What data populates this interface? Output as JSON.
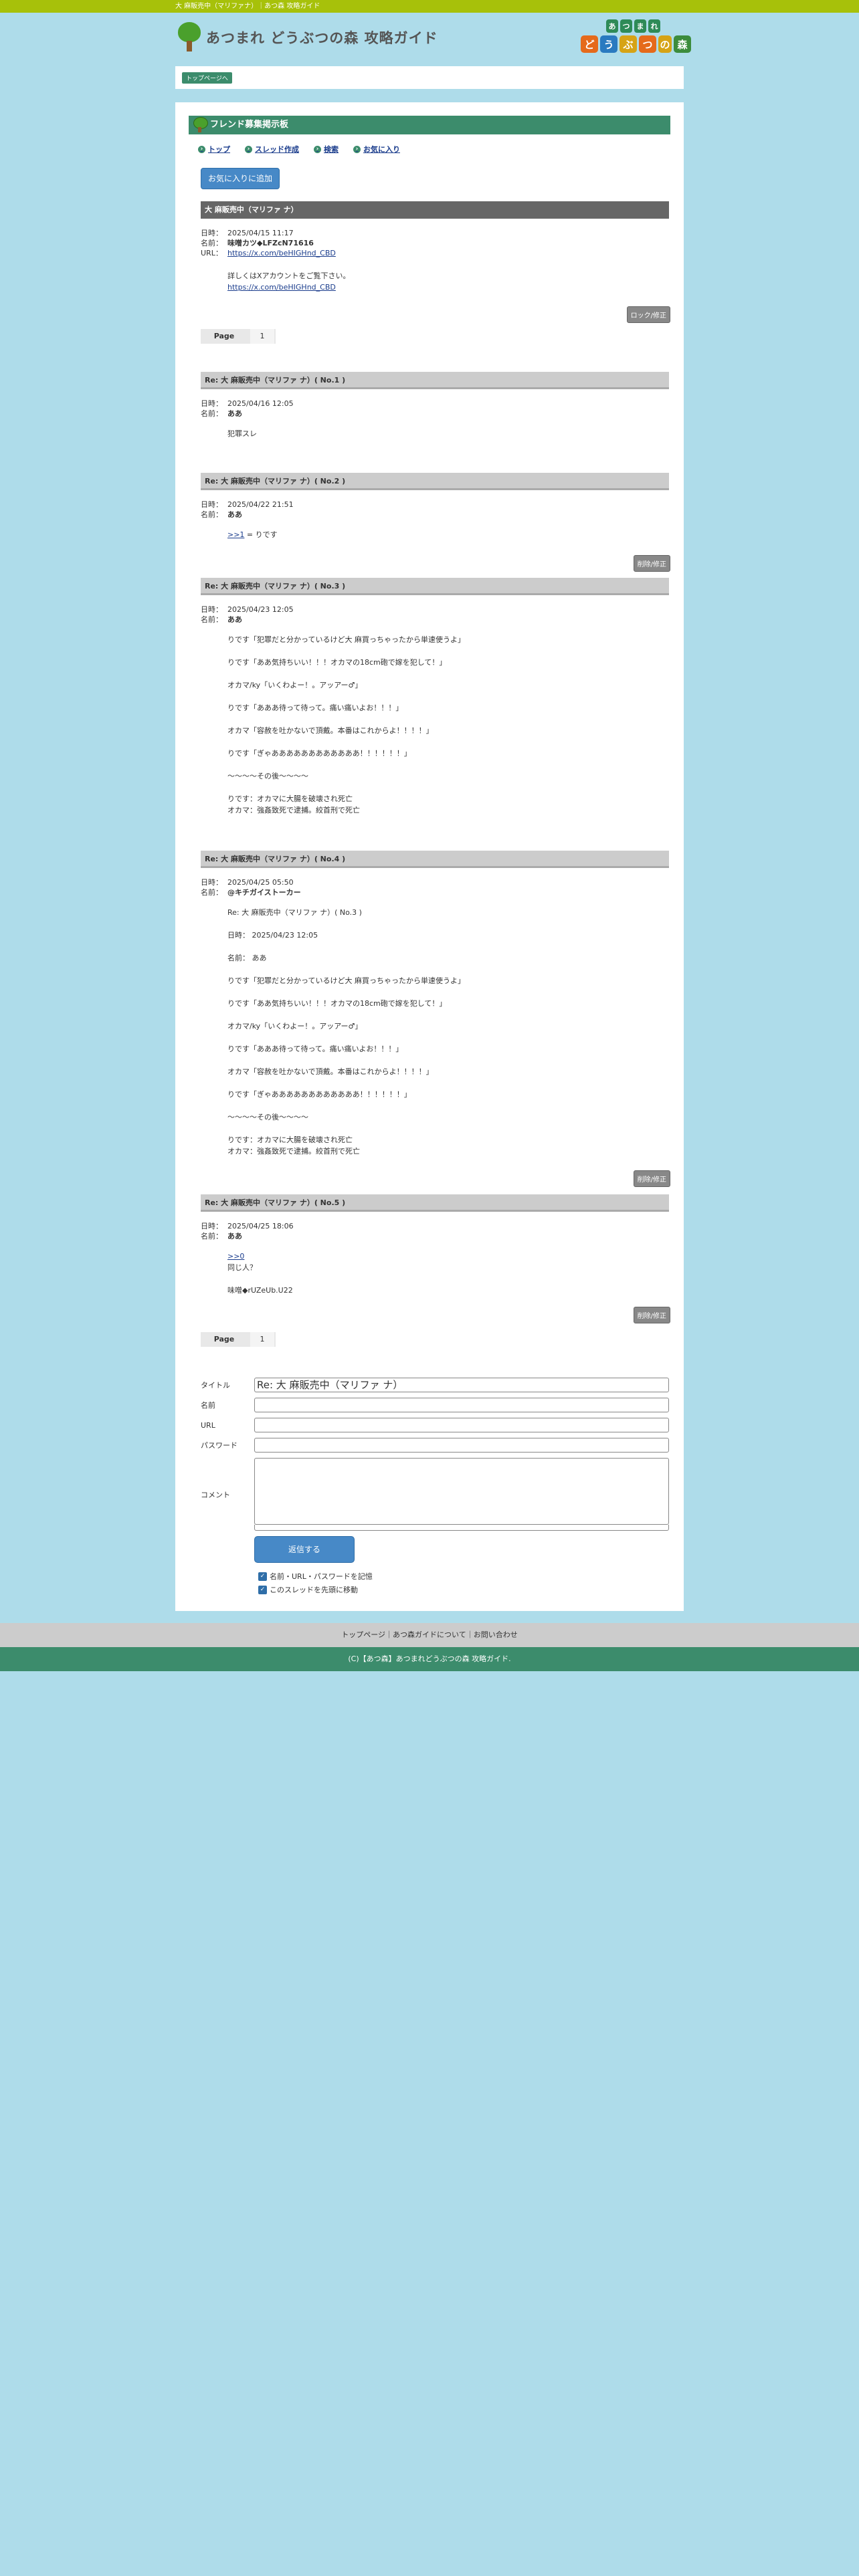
{
  "topbar": {
    "title": "大 麻販売中（マリファナ）｜あつ森 攻略ガイド"
  },
  "header": {
    "site_title": "あつまれ どうぶつの森 攻略ガイド",
    "corner_logo": {
      "top": [
        "あ",
        "つ",
        "ま",
        "れ"
      ],
      "bottom": [
        "ど",
        "う",
        "ぶ",
        "つ",
        "の",
        "森"
      ]
    },
    "colors": {
      "green": "#3c8c6c",
      "yellowgreen": "#a7c10a"
    }
  },
  "breadcrumb": {
    "label": "トップページへ"
  },
  "board": {
    "title": "フレンド募集掲示板",
    "nav": [
      {
        "label": "トップ",
        "icon": "circle-arrow-icon"
      },
      {
        "label": "スレッド作成",
        "icon": "circle-arrow-icon"
      },
      {
        "label": "検索",
        "icon": "circle-arrow-icon"
      },
      {
        "label": "お気に入り",
        "icon": "circle-arrow-icon"
      }
    ],
    "fav_button": "お気に入りに追加"
  },
  "thread": {
    "title": "大 麻販売中（マリファ ナ）",
    "date_label": "日時：",
    "name_label": "名前：",
    "url_label": "URL：",
    "date": "2025/04/15 11:17",
    "name": "味噌カツ◆LFZcN71616",
    "url": "https://x.com/beHIGHnd_CBD",
    "body_lines": [
      "詳しくはXアカウントをご覧下さい。"
    ],
    "body_link": "https://x.com/beHIGHnd_CBD",
    "action": "ロック/修正"
  },
  "pager": {
    "label": "Page",
    "num": "1"
  },
  "replies": [
    {
      "title": "Re: 大 麻販売中（マリファ ナ）( No.1 )",
      "date": "2025/04/16 12:05",
      "name": "ああ",
      "body": "犯罪スレ",
      "action": ""
    },
    {
      "title": "Re: 大 麻販売中（マリファ ナ）( No.2 )",
      "date": "2025/04/22 21:51",
      "name": "ああ",
      "link": ">>1",
      "body": " = りです",
      "action": "削除/修正"
    },
    {
      "title": "Re: 大 麻販売中（マリファ ナ）( No.3 )",
      "date": "2025/04/23 12:05",
      "name": "ああ",
      "body": "りです「犯罪だと分かっているけど大 麻買っちゃったから単速使うよ」\n\nりです「ああ気持ちいい！！！オカマの18cm砲で嫁を犯して！」\n\nオカマ/ky「いくわよー！。アッアー♂」\n\nりです「あああ待って待って。痛い痛いよお！！！」\n\nオカマ「容赦を吐かないで頂戴。本番はこれからよ！！！！」\n\nりです「ぎゃああああああああああああ！！！！！！」\n\n～～～～その後～～～～\n\nりです：オカマに大腸を破壊され死亡\nオカマ：強姦致死で逮捕。絞首刑で死亡",
      "action": ""
    },
    {
      "title": "Re: 大 麻販売中（マリファ ナ）( No.4 )",
      "date": "2025/04/25 05:50",
      "name": "@キチガイストーカー",
      "body": "Re: 大 麻販売中（マリファ ナ）( No.3 )\n\n日時： 2025/04/23 12:05\n\n名前： ああ\n\nりです「犯罪だと分かっているけど大 麻買っちゃったから単速使うよ」\n\nりです「ああ気持ちいい！！！オカマの18cm砲で嫁を犯して！」\n\nオカマ/ky「いくわよー！。アッアー♂」\n\nりです「あああ待って待って。痛い痛いよお！！！」\n\nオカマ「容赦を吐かないで頂戴。本番はこれからよ！！！！」\n\nりです「ぎゃああああああああああああ！！！！！！」\n\n～～～～その後～～～～\n\nりです：オカマに大腸を破壊され死亡\nオカマ：強姦致死で逮捕。絞首刑で死亡",
      "action": "削除/修正"
    },
    {
      "title": "Re: 大 麻販売中（マリファ ナ）( No.5 )",
      "date": "2025/04/25 18:06",
      "name": "ああ",
      "link": ">>0",
      "body": "同じ人？\n\n味噌◆rUZeUb.U22",
      "action": "削除/修正"
    }
  ],
  "form": {
    "title_label": "タイトル",
    "title_value": "Re: 大 麻販売中（マリファ ナ）",
    "name_label": "名前",
    "url_label": "URL",
    "password_label": "パスワード",
    "comment_label": "コメント",
    "submit": "返信する",
    "check1": "名前・URL・パスワードを記憶",
    "check2": "このスレッドを先頭に移動"
  },
  "footer": {
    "links": "トップページ｜あつ森ガイドについて｜お問い合わせ",
    "copyright": "(C)【あつ森】あつまれどうぶつの森 攻略ガイド."
  }
}
